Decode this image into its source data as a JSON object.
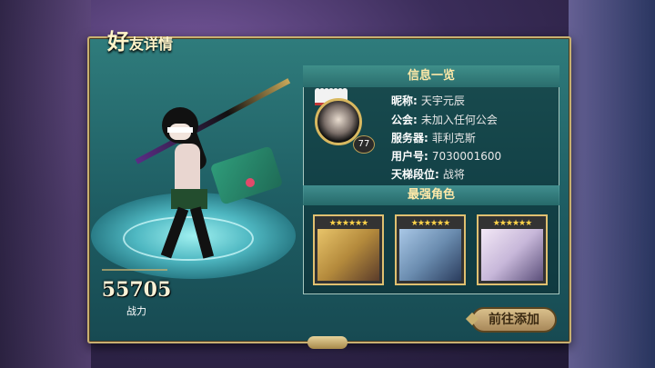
{
  "title": {
    "big": "好",
    "small": "友详情"
  },
  "info_header": "信息一览",
  "profile": {
    "level": "77",
    "rows": [
      {
        "label": "昵称:",
        "value": "天宇元辰"
      },
      {
        "label": "公会:",
        "value": "未加入任何公会"
      },
      {
        "label": "服务器:",
        "value": "菲利克斯"
      },
      {
        "label": "用户号:",
        "value": "7030001600"
      },
      {
        "label": "天梯段位:",
        "value": "战将"
      }
    ]
  },
  "strongest_header": "最强角色",
  "cards": [
    {
      "stars": "★★★★★★"
    },
    {
      "stars": "★★★★★★"
    },
    {
      "stars": "★★★★★★"
    }
  ],
  "power": {
    "value": "55705",
    "label": "战力"
  },
  "add_button": "前往添加",
  "colors": {
    "panel": "#1e5d63",
    "border": "#c8b070",
    "header_text": "#ffe9a8"
  }
}
